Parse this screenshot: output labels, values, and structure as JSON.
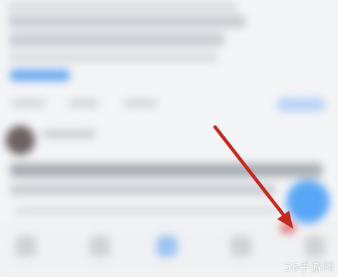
{
  "app": {
    "screen": "blurred-post-detail"
  },
  "annotation": {
    "arrow_color": "#c6281e",
    "target": "floating-action-button"
  },
  "colors": {
    "accent": "#5aa6f6",
    "link": "#6aa8f0",
    "background": "#f4f5f7"
  },
  "icons": {
    "fab": "edit-icon",
    "nav": [
      "home-icon",
      "discover-icon",
      "add-icon",
      "message-icon",
      "profile-icon"
    ]
  },
  "watermark": {
    "text": "56手游网"
  }
}
